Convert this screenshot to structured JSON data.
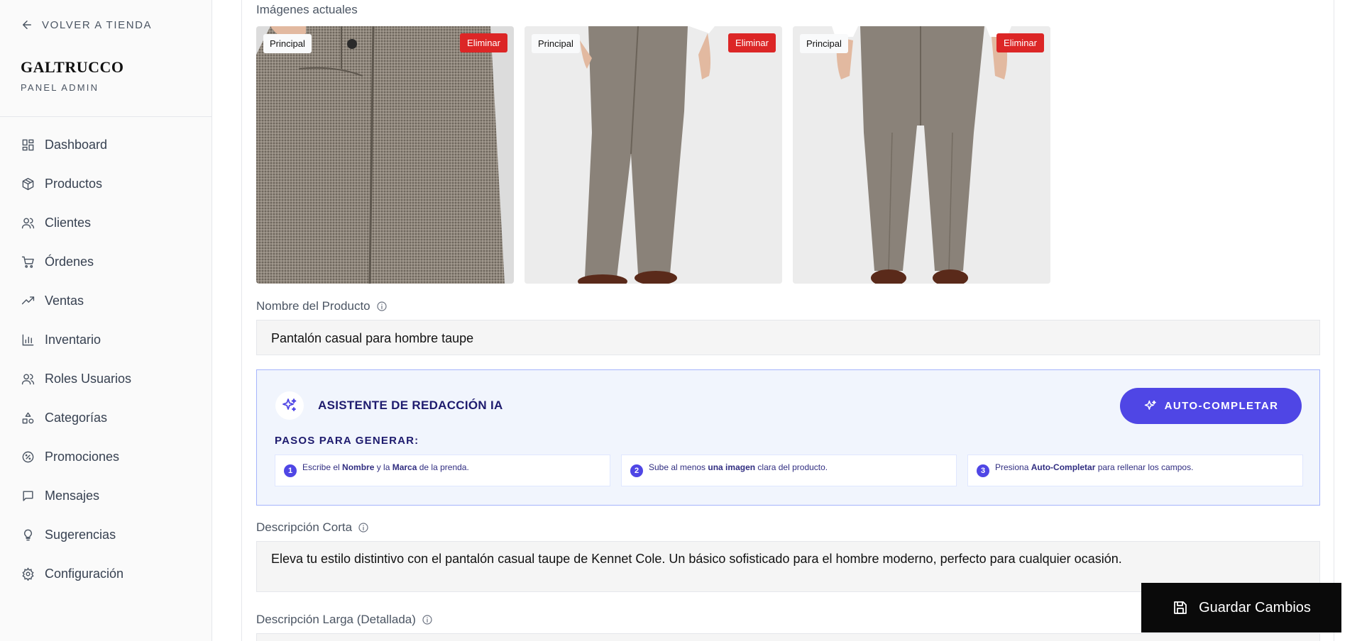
{
  "sidebar": {
    "back_label": "VOLVER A TIENDA",
    "brand": "GALTRUCCO",
    "brand_sub": "PANEL ADMIN",
    "items": [
      {
        "label": "Dashboard",
        "icon": "dashboard-icon"
      },
      {
        "label": "Productos",
        "icon": "box-icon"
      },
      {
        "label": "Clientes",
        "icon": "users-icon"
      },
      {
        "label": "Órdenes",
        "icon": "cart-icon"
      },
      {
        "label": "Ventas",
        "icon": "trending-up-icon"
      },
      {
        "label": "Inventario",
        "icon": "bar-chart-icon"
      },
      {
        "label": "Roles Usuarios",
        "icon": "user-roles-icon"
      },
      {
        "label": "Categorías",
        "icon": "shapes-icon"
      },
      {
        "label": "Promociones",
        "icon": "percent-badge-icon"
      },
      {
        "label": "Mensajes",
        "icon": "message-icon"
      },
      {
        "label": "Sugerencias",
        "icon": "lightbulb-icon"
      },
      {
        "label": "Configuración",
        "icon": "gear-icon"
      }
    ]
  },
  "main": {
    "current_images_label": "Imágenes actuales",
    "images": [
      {
        "badge": "Principal",
        "delete_label": "Eliminar"
      },
      {
        "badge": "Principal",
        "delete_label": "Eliminar"
      },
      {
        "badge": "Principal",
        "delete_label": "Eliminar"
      }
    ],
    "name_label": "Nombre del Producto",
    "name_value": "Pantalón casual para hombre taupe",
    "ai": {
      "title": "ASISTENTE DE REDACCIÓN IA",
      "button": "AUTO-COMPLETAR",
      "steps_title": "PASOS PARA GENERAR:",
      "steps": [
        {
          "num": "1",
          "pre": "Escribe el ",
          "b1": "Nombre",
          "mid": " y la ",
          "b2": "Marca",
          "post": " de la prenda."
        },
        {
          "num": "2",
          "pre": "Sube al menos ",
          "b1": "una imagen",
          "mid": " clara del producto.",
          "b2": "",
          "post": ""
        },
        {
          "num": "3",
          "pre": "Presiona ",
          "b1": "Auto-Completar",
          "mid": " para rellenar los campos.",
          "b2": "",
          "post": ""
        }
      ]
    },
    "short_desc_label": "Descripción Corta",
    "short_desc_value": "Eleva tu estilo distintivo con el pantalón casual taupe de Kennet Cole. Un básico sofisticado para el hombre moderno, perfecto para cualquier ocasión.",
    "long_desc_label": "Descripción Larga (Detallada)",
    "long_desc_value": ""
  },
  "save_button": "Guardar Cambios",
  "colors": {
    "accent": "#4f46e5",
    "danger": "#dc2626",
    "ai_bg": "#f1f5fd",
    "ai_border": "#a5b4fc"
  }
}
